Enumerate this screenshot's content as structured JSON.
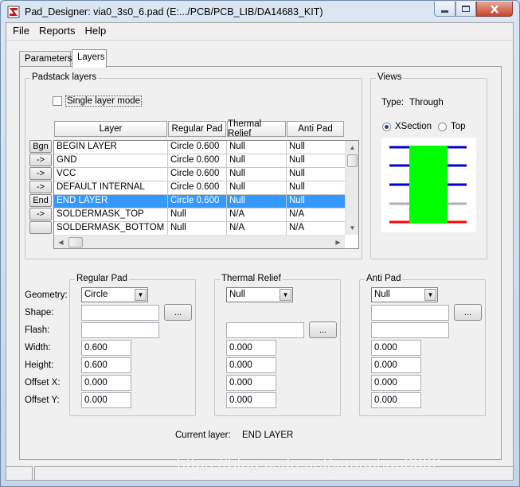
{
  "window": {
    "title": "Pad_Designer: via0_3s0_6.pad (E:.../PCB/PCB_LIB/DA14683_KIT)"
  },
  "menu": [
    "File",
    "Reports",
    "Help"
  ],
  "tabs": {
    "parameters": "Parameters",
    "layers": "Layers"
  },
  "padstack": {
    "group_label": "Padstack layers",
    "single_layer_mode_label": "Single layer mode",
    "single_layer_mode_checked": false,
    "headers": [
      "Layer",
      "Regular Pad",
      "Thermal Relief",
      "Anti Pad"
    ],
    "row_buttons": [
      "Bgn",
      "->",
      "->",
      "->",
      "End",
      "->",
      ""
    ],
    "rows": [
      {
        "layer": "BEGIN LAYER",
        "regular": "Circle 0.600",
        "thermal": "Null",
        "anti": "Null",
        "selected": false
      },
      {
        "layer": "GND",
        "regular": "Circle 0.600",
        "thermal": "Null",
        "anti": "Null",
        "selected": false
      },
      {
        "layer": "VCC",
        "regular": "Circle 0.600",
        "thermal": "Null",
        "anti": "Null",
        "selected": false
      },
      {
        "layer": "DEFAULT INTERNAL",
        "regular": "Circle 0.600",
        "thermal": "Null",
        "anti": "Null",
        "selected": false
      },
      {
        "layer": "END LAYER",
        "regular": "Circle 0.600",
        "thermal": "Null",
        "anti": "Null",
        "selected": true
      },
      {
        "layer": "SOLDERMASK_TOP",
        "regular": "Null",
        "thermal": "N/A",
        "anti": "N/A",
        "selected": false
      },
      {
        "layer": "SOLDERMASK_BOTTOM",
        "regular": "Null",
        "thermal": "N/A",
        "anti": "N/A",
        "selected": false
      }
    ]
  },
  "views": {
    "group_label": "Views",
    "type_label": "Type:",
    "type_value": "Through",
    "xsection_label": "XSection",
    "top_label": "Top",
    "selected_view": "XSection",
    "colors": {
      "layer": "#0000cc",
      "pad": "#00ff00",
      "mask": "#b0b0b0",
      "end": "#ff0000"
    }
  },
  "field_labels": {
    "geometry": "Geometry:",
    "shape": "Shape:",
    "flash": "Flash:",
    "width": "Width:",
    "height": "Height:",
    "offset_x": "Offset X:",
    "offset_y": "Offset Y:"
  },
  "regular_pad": {
    "label": "Regular Pad",
    "geometry": "Circle",
    "shape": "",
    "flash": "",
    "width": "0.600",
    "height": "0.600",
    "offset_x": "0.000",
    "offset_y": "0.000",
    "browse": "..."
  },
  "thermal_relief": {
    "label": "Thermal Relief",
    "geometry": "Null",
    "shape": "",
    "width": "0.000",
    "height": "0.000",
    "offset_x": "0.000",
    "offset_y": "0.000",
    "browse": "..."
  },
  "anti_pad": {
    "label": "Anti Pad",
    "geometry": "Null",
    "shape": "",
    "flash": "",
    "width": "0.000",
    "height": "0.000",
    "offset_x": "0.000",
    "offset_y": "0.000",
    "browse": "..."
  },
  "current_layer": {
    "label": "Current layer:",
    "value": "END LAYER"
  },
  "watermark": "https://blog.csdn.net/jiangchao3392"
}
